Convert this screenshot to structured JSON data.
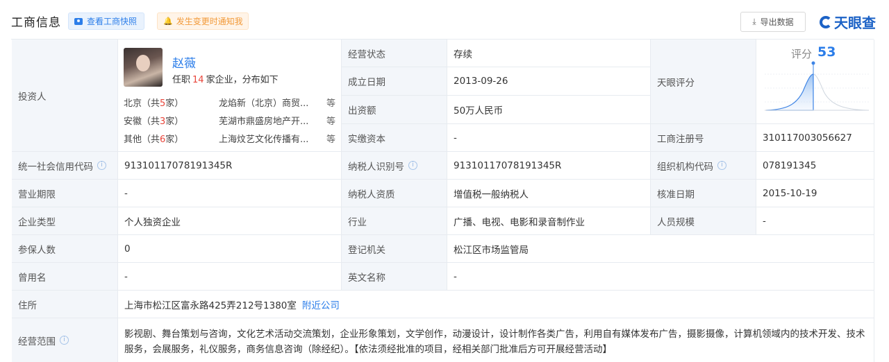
{
  "header": {
    "title": "工商信息",
    "snapshot_label": "查看工商快照",
    "notify_label": "发生变更时通知我",
    "export_label": "导出数据",
    "logo_text": "天眼查",
    "brand_color": "#2b7de9"
  },
  "investor": {
    "label": "投资人",
    "name": "赵薇",
    "summary_prefix": "任职",
    "summary_count": "14",
    "summary_suffix": "家企业，分布如下",
    "regions": [
      {
        "region": "北京（共",
        "count": "5",
        "suffix": "家）",
        "company": "龙焰新（北京）商贸...",
        "more": "等"
      },
      {
        "region": "安徽（共",
        "count": "3",
        "suffix": "家）",
        "company": "芜湖市鼎盛房地产开...",
        "more": "等"
      },
      {
        "region": "其他（共",
        "count": "6",
        "suffix": "家）",
        "company": "上海炆艺文化传播有...",
        "more": "等"
      }
    ]
  },
  "fields": {
    "status_label": "经营状态",
    "status_value": "存续",
    "found_label": "成立日期",
    "found_value": "2013-09-26",
    "capital_label": "出资额",
    "capital_value": "50万人民币",
    "paid_label": "实缴资本",
    "paid_value": "-",
    "score_label": "天眼评分",
    "reg_no_label": "工商注册号",
    "reg_no_value": "310117003056627",
    "credit_label": "统一社会信用代码",
    "credit_value": "91310117078191345R",
    "taxpayer_label": "纳税人识别号",
    "taxpayer_value": "91310117078191345R",
    "org_label": "组织机构代码",
    "org_value": "078191345",
    "term_label": "营业期限",
    "term_value": "-",
    "tax_q_label": "纳税人资质",
    "tax_q_value": "增值税一般纳税人",
    "approve_label": "核准日期",
    "approve_value": "2015-10-19",
    "type_label": "企业类型",
    "type_value": "个人独资企业",
    "industry_label": "行业",
    "industry_value": "广播、电视、电影和录音制作业",
    "staff_label": "人员规模",
    "staff_value": "-",
    "insured_label": "参保人数",
    "insured_value": "0",
    "authority_label": "登记机关",
    "authority_value": "松江区市场监管局",
    "former_label": "曾用名",
    "former_value": "-",
    "english_label": "英文名称",
    "english_value": "-",
    "address_label": "住所",
    "address_value": "上海市松江区富永路425弄212号1380室",
    "address_link": "附近公司",
    "scope_label": "经营范围",
    "scope_value": "影视剧、舞台策划与咨询，文化艺术活动交流策划，企业形象策划，文学创作，动漫设计，设计制作各类广告，利用自有媒体发布广告，摄影摄像，计算机领域内的技术开发、技术服务，会展服务，礼仪服务，商务信息咨询（除经纪）。【依法须经批准的项目，经相关部门批准后方可开展经营活动】"
  },
  "score": {
    "label": "评分",
    "value": "53"
  }
}
